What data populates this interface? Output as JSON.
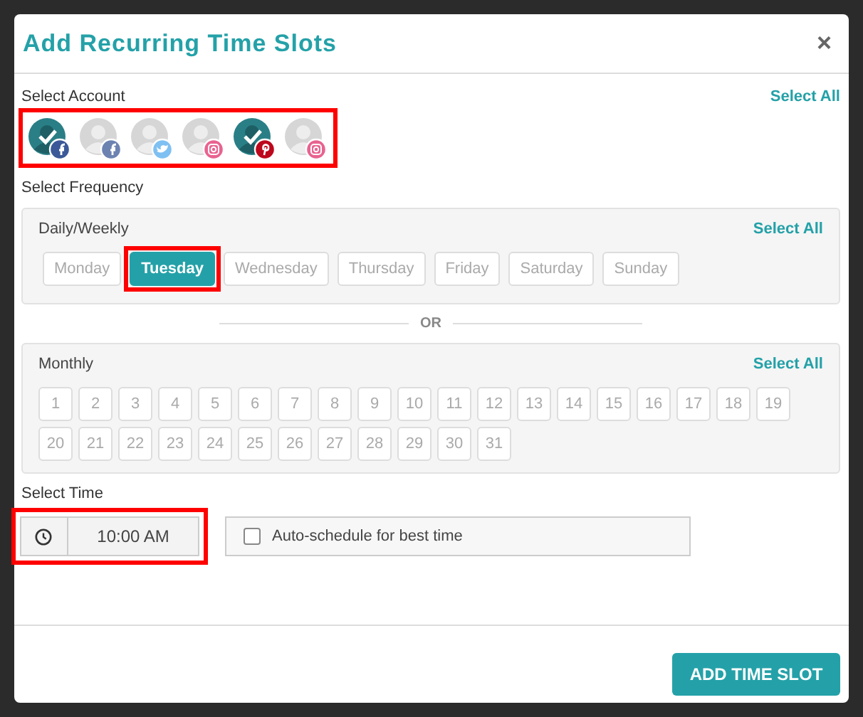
{
  "dialog": {
    "title": "Add Recurring Time Slots",
    "close": "×"
  },
  "accounts": {
    "label": "Select Account",
    "select_all": "Select All",
    "highlighted": true,
    "items": [
      {
        "kind": "facebook",
        "selected": true
      },
      {
        "kind": "facebook",
        "selected": false
      },
      {
        "kind": "twitter",
        "selected": false
      },
      {
        "kind": "instagram",
        "selected": false
      },
      {
        "kind": "pinterest",
        "selected": true
      },
      {
        "kind": "instagram",
        "selected": false
      }
    ]
  },
  "frequency": {
    "label": "Select Frequency",
    "weekly": {
      "label": "Daily/Weekly",
      "select_all": "Select All",
      "days": [
        {
          "label": "Monday",
          "selected": false,
          "highlighted": false
        },
        {
          "label": "Tuesday",
          "selected": true,
          "highlighted": true
        },
        {
          "label": "Wednesday",
          "selected": false,
          "highlighted": false
        },
        {
          "label": "Thursday",
          "selected": false,
          "highlighted": false
        },
        {
          "label": "Friday",
          "selected": false,
          "highlighted": false
        },
        {
          "label": "Saturday",
          "selected": false,
          "highlighted": false
        },
        {
          "label": "Sunday",
          "selected": false,
          "highlighted": false
        }
      ]
    },
    "separator": "OR",
    "monthly": {
      "label": "Monthly",
      "select_all": "Select All",
      "days": [
        {
          "label": "1",
          "selected": false
        },
        {
          "label": "2",
          "selected": false
        },
        {
          "label": "3",
          "selected": false
        },
        {
          "label": "4",
          "selected": false
        },
        {
          "label": "5",
          "selected": false
        },
        {
          "label": "6",
          "selected": false
        },
        {
          "label": "7",
          "selected": false
        },
        {
          "label": "8",
          "selected": false
        },
        {
          "label": "9",
          "selected": false
        },
        {
          "label": "10",
          "selected": false
        },
        {
          "label": "11",
          "selected": false
        },
        {
          "label": "12",
          "selected": false
        },
        {
          "label": "13",
          "selected": false
        },
        {
          "label": "14",
          "selected": false
        },
        {
          "label": "15",
          "selected": false
        },
        {
          "label": "16",
          "selected": false
        },
        {
          "label": "17",
          "selected": false
        },
        {
          "label": "18",
          "selected": false
        },
        {
          "label": "19",
          "selected": false
        },
        {
          "label": "20",
          "selected": false
        },
        {
          "label": "21",
          "selected": false
        },
        {
          "label": "22",
          "selected": false
        },
        {
          "label": "23",
          "selected": false
        },
        {
          "label": "24",
          "selected": false
        },
        {
          "label": "25",
          "selected": false
        },
        {
          "label": "26",
          "selected": false
        },
        {
          "label": "27",
          "selected": false
        },
        {
          "label": "28",
          "selected": false
        },
        {
          "label": "29",
          "selected": false
        },
        {
          "label": "30",
          "selected": false
        },
        {
          "label": "31",
          "selected": false
        }
      ]
    }
  },
  "time": {
    "label": "Select Time",
    "value": "10:00 AM",
    "highlighted": true,
    "auto_schedule": {
      "label": "Auto-schedule for best time",
      "checked": false
    }
  },
  "submit": "ADD TIME SLOT"
}
